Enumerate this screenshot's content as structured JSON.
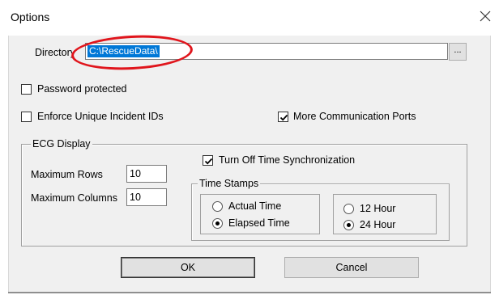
{
  "window": {
    "title": "Options"
  },
  "directory": {
    "label": "Directory",
    "value": "C:\\RescueData\\",
    "browse_label": "..."
  },
  "checkboxes": {
    "password_protected": {
      "label": "Password protected",
      "checked": false
    },
    "enforce_unique_ids": {
      "label": "Enforce Unique Incident IDs",
      "checked": false
    },
    "more_comm_ports": {
      "label": "More Communication Ports",
      "checked": true
    },
    "turn_off_time_sync": {
      "label": "Turn Off Time Synchronization",
      "checked": true
    }
  },
  "ecg_display": {
    "title": "ECG Display",
    "max_rows": {
      "label": "Maximum Rows",
      "value": "10"
    },
    "max_columns": {
      "label": "Maximum Columns",
      "value": "10"
    }
  },
  "time_stamps": {
    "title": "Time Stamps",
    "mode": {
      "options": [
        "Actual Time",
        "Elapsed Time"
      ],
      "selected": "Elapsed Time"
    },
    "clock": {
      "options": [
        "12 Hour",
        "24 Hour"
      ],
      "selected": "24 Hour"
    }
  },
  "buttons": {
    "ok": "OK",
    "cancel": "Cancel"
  },
  "colors": {
    "selection": "#0078d7",
    "annotation": "#e0151c",
    "dialog_bg": "#f0f0f0"
  },
  "icons": {
    "close": "close-icon",
    "checkmark": "check-icon"
  }
}
